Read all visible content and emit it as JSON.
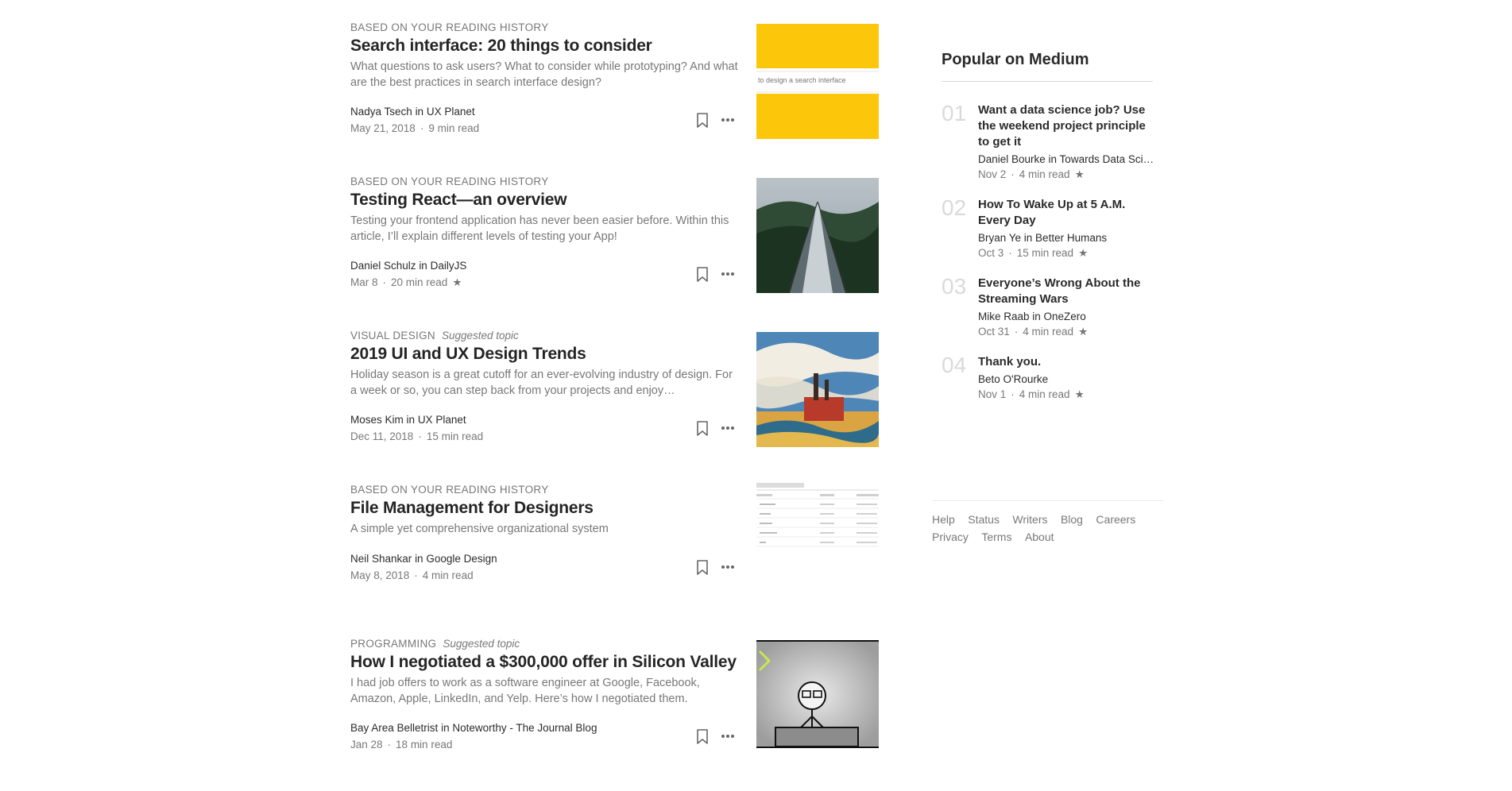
{
  "feed": {
    "posts": [
      {
        "context": "BASED ON YOUR READING HISTORY",
        "topic_type": "",
        "title": "Search interface: 20 things to consider",
        "subtitle": "What questions to ask users? What to consider while prototyping? And what are the best practices in search interface design?",
        "author": "Nadya Tsech",
        "in": "in",
        "publication": "UX Planet",
        "date": "May 21, 2018",
        "read_time": "9 min read",
        "star": "",
        "thumb_caption": "to design a search interface"
      },
      {
        "context": "BASED ON YOUR READING HISTORY",
        "topic_type": "",
        "title": "Testing React—an overview",
        "subtitle": "Testing your frontend application has never been easier before. Within this article, I’ll explain different levels of testing your App!",
        "author": "Daniel Schulz",
        "in": "in",
        "publication": "DailyJS",
        "date": "Mar 8",
        "read_time": "20 min read",
        "star": "★"
      },
      {
        "context": "VISUAL DESIGN",
        "topic_type": "Suggested topic",
        "title": "2019 UI and UX Design Trends",
        "subtitle": "Holiday season is a great cutoff for an ever-evolving industry of design. For a week or so, you can step back from your projects and enjoy…",
        "author": "Moses Kim",
        "in": "in",
        "publication": "UX Planet",
        "date": "Dec 11, 2018",
        "read_time": "15 min read",
        "star": ""
      },
      {
        "context": "BASED ON YOUR READING HISTORY",
        "topic_type": "",
        "title": "File Management for Designers",
        "subtitle": "A simple yet comprehensive organizational system",
        "author": "Neil Shankar",
        "in": "in",
        "publication": "Google Design",
        "date": "May 8, 2018",
        "read_time": "4 min read",
        "star": ""
      },
      {
        "context": "PROGRAMMING",
        "topic_type": "Suggested topic",
        "title": "How I negotiated a $300,000 offer in Silicon Valley",
        "subtitle": "I had job offers to work as a software engineer at Google, Facebook, Amazon, Apple, LinkedIn, and Yelp. Here’s how I negotiated them.",
        "author": "Bay Area Belletrist",
        "in": "in",
        "publication": "Noteworthy - The Journal Blog",
        "date": "Jan 28",
        "read_time": "18 min read",
        "star": ""
      }
    ]
  },
  "sidebar": {
    "title": "Popular on Medium",
    "items": [
      {
        "num": "01",
        "headline": "Want a data science job? Use the weekend project principle to get it",
        "author": "Daniel Bourke in Towards Data Sci…",
        "date": "Nov 2",
        "read_time": "4 min read",
        "star": "★"
      },
      {
        "num": "02",
        "headline": "How To Wake Up at 5 A.M. Every Day",
        "author": "Bryan Ye in Better Humans",
        "date": "Oct 3",
        "read_time": "15 min read",
        "star": "★"
      },
      {
        "num": "03",
        "headline": "Everyone’s Wrong About the Streaming Wars",
        "author": "Mike Raab in OneZero",
        "date": "Oct 31",
        "read_time": "4 min read",
        "star": "★"
      },
      {
        "num": "04",
        "headline": "Thank you.",
        "author": "Beto O'Rourke",
        "date": "Nov 1",
        "read_time": "4 min read",
        "star": "★"
      }
    ]
  },
  "footer": {
    "links": [
      "Help",
      "Status",
      "Writers",
      "Blog",
      "Careers",
      "Privacy",
      "Terms",
      "About"
    ]
  },
  "colors": {
    "accent_yellow": "#fcc70a",
    "text_primary": "#1f1f1f",
    "text_muted": "#757575"
  },
  "icons": {
    "bookmark": "bookmark-icon",
    "more": "more-options-icon"
  }
}
